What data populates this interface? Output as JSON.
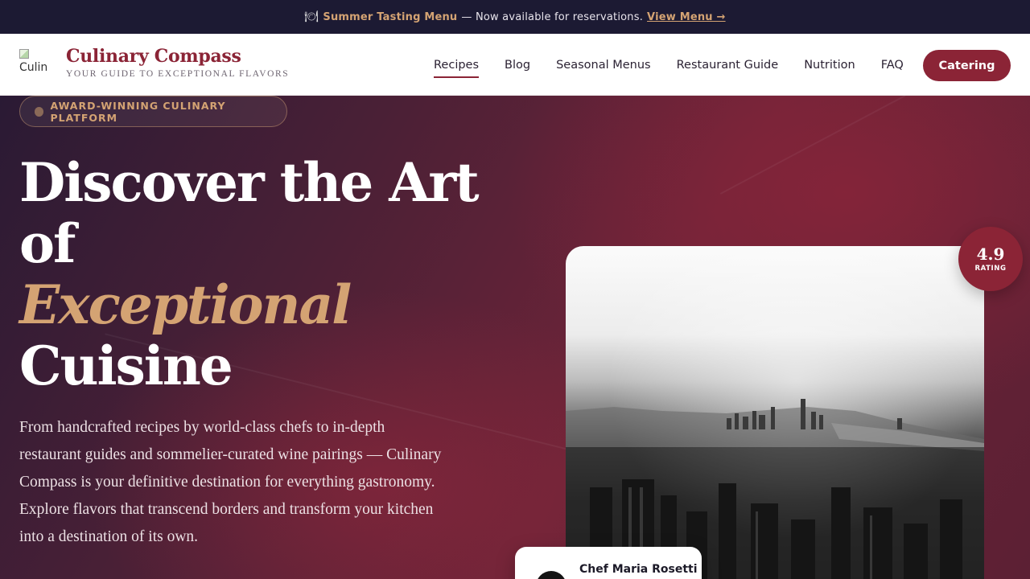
{
  "announcement": {
    "icon": "plate-cutlery-icon",
    "highlight": "Summer Tasting Menu",
    "text": "— Now available for reservations.",
    "link": "View Menu →"
  },
  "header": {
    "logo_alt": "Culin",
    "brand_name": "Culinary Compass",
    "tagline": "YOUR GUIDE TO EXCEPTIONAL FLAVORS",
    "nav": [
      {
        "label": "Recipes",
        "active": true
      },
      {
        "label": "Blog"
      },
      {
        "label": "Seasonal Menus"
      },
      {
        "label": "Restaurant Guide"
      },
      {
        "label": "Nutrition"
      },
      {
        "label": "FAQ"
      }
    ],
    "cta": "Catering"
  },
  "hero": {
    "badge": "AWARD-WINNING CULINARY PLATFORM",
    "headline_line1": "Discover the Art",
    "headline_line2": "of",
    "headline_accent": "Exceptional",
    "headline_line4": "Cuisine",
    "description": "From handcrafted recipes by world-class chefs to in-depth restaurant guides and sommelier-curated wine pairings — Culinary Compass is your definitive destination for everything gastronomy. Explore flavors that transcend borders and transform your kitchen into a destination of its own.",
    "rating_value": "4.9",
    "rating_label": "RATING",
    "chef_name": "Chef Maria Rosetti"
  },
  "colors": {
    "brand": "#8b2436",
    "accent_gold": "#d4a373",
    "topbar": "#1c1a33"
  }
}
